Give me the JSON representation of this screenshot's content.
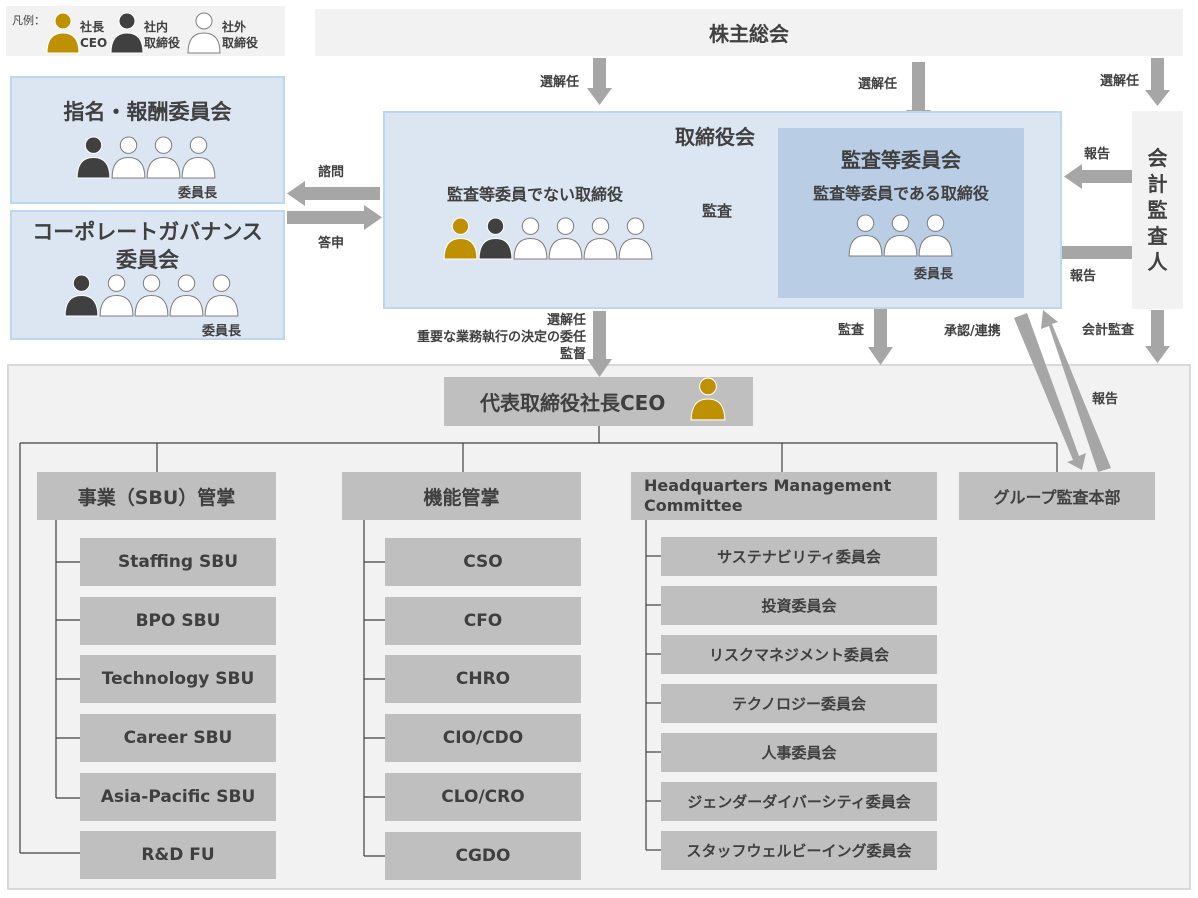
{
  "legend": {
    "prefix": "凡例：",
    "ceo": [
      "社長",
      "CEO"
    ],
    "internal": [
      "社内",
      "取締役"
    ],
    "external": [
      "社外",
      "取締役"
    ]
  },
  "colors": {
    "ceo": "#bf9000",
    "internal": "#404040",
    "external": "#ffffff"
  },
  "shareholders": "株主総会",
  "nomination_committee": {
    "title": "指名・報酬委員会",
    "chair": "委員長",
    "members": [
      "internal",
      "external",
      "external",
      "external"
    ]
  },
  "governance_committee": {
    "title_lines": [
      "コーポレートガバナンス",
      "委員会"
    ],
    "chair": "委員長",
    "members": [
      "internal",
      "external",
      "external",
      "external",
      "external"
    ]
  },
  "board": {
    "title": "取締役会",
    "non_audit_label": "監査等委員でない取締役",
    "non_audit_members": [
      "ceo",
      "internal",
      "external",
      "external",
      "external",
      "external"
    ]
  },
  "audit_committee": {
    "title": "監査等委員会",
    "subtitle": "監査等委員である取締役",
    "chair": "委員長",
    "members": [
      "external",
      "external",
      "external"
    ]
  },
  "auditor": {
    "chars": [
      "会",
      "計",
      "監",
      "査",
      "人"
    ]
  },
  "arrows": {
    "elect1": "選解任",
    "elect2": "選解任",
    "elect3": "選解任",
    "consult": "諮問",
    "answer": "答申",
    "audit_internal": "監査",
    "report_top": "報告",
    "report_mid": "報告",
    "report_bottom": "報告",
    "audit_down": "監査",
    "approval": "承認/連携",
    "account_audit": "会計監査",
    "board_down": [
      "選解任",
      "重要な業務執行の決定の委任",
      "監督"
    ]
  },
  "ceo_box": "代表取締役社長CEO",
  "groups": {
    "business": {
      "title": "事業（SBU）管掌",
      "items": [
        "Staffing SBU",
        "BPO SBU",
        "Technology SBU",
        "Career SBU",
        "Asia-Pacific SBU"
      ],
      "extra": "R&D FU"
    },
    "functions": {
      "title": "機能管掌",
      "items": [
        "CSO",
        "CFO",
        "CHRO",
        "CIO/CDO",
        "CLO/CRO",
        "CGDO"
      ]
    },
    "hq": {
      "title_lines": [
        "Headquarters Management",
        "Committee"
      ],
      "items": [
        "サステナビリティ委員会",
        "投資委員会",
        "リスクマネジメント委員会",
        "テクノロジー委員会",
        "人事委員会",
        "ジェンダーダイバーシティ委員会",
        "スタッフウェルビーイング委員会"
      ]
    },
    "audit_dept": "グループ監査本部"
  }
}
